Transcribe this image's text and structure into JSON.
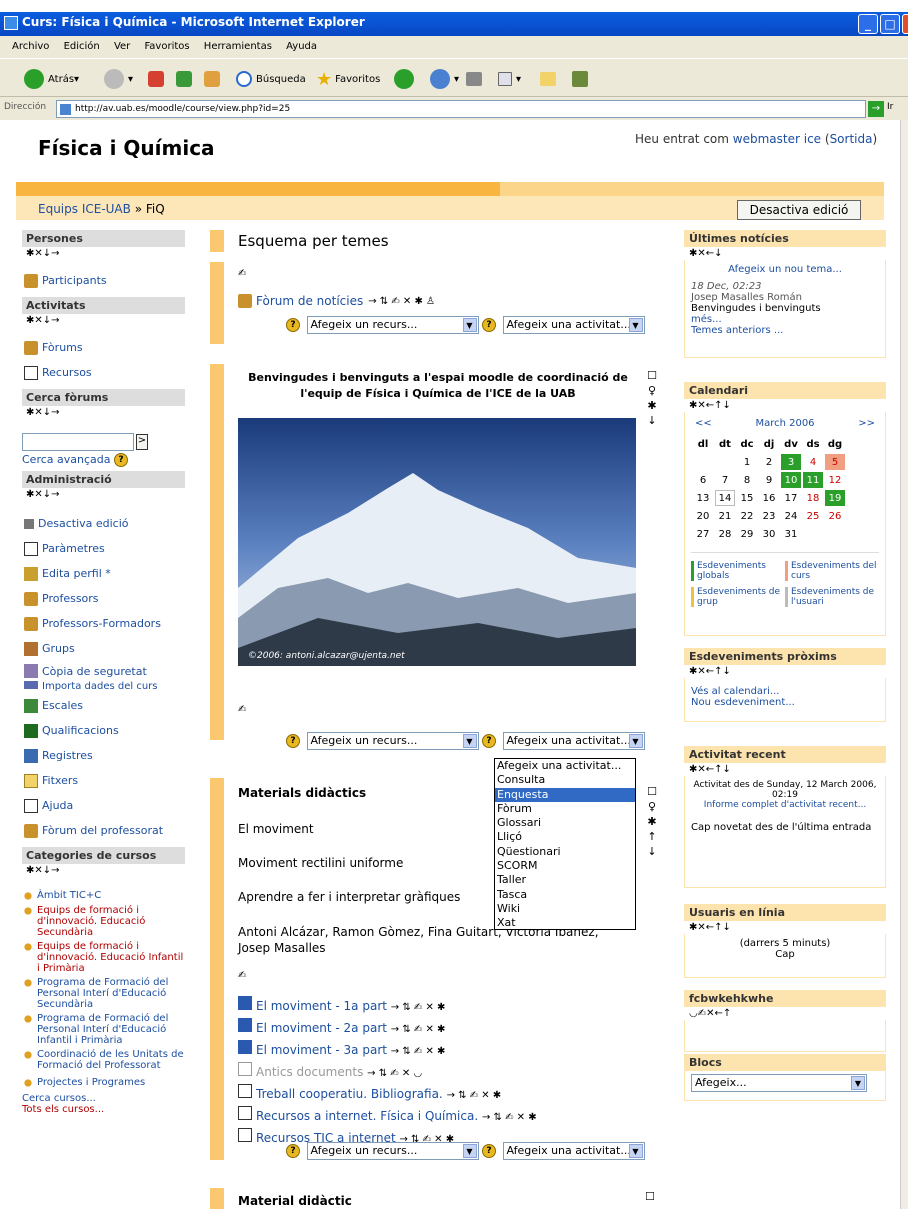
{
  "window": {
    "title": "Curs: Física i Química - Microsoft Internet Explorer"
  },
  "menu": [
    "Archivo",
    "Edición",
    "Ver",
    "Favoritos",
    "Herramientas",
    "Ayuda"
  ],
  "toolbar": {
    "back": "Atrás",
    "search": "Búsqueda",
    "favorites": "Favoritos"
  },
  "address": {
    "label": "Dirección",
    "url": "http://av.uab.es/moodle/course/view.php?id=25",
    "go": "Ir"
  },
  "header": {
    "title": "Física i Química",
    "login_prefix": "Heu entrat com",
    "login_user": "webmaster ice",
    "logout": "Sortida"
  },
  "nav": {
    "crumb1": "Equips ICE-UAB",
    "sep": "»",
    "crumb2": "FiQ",
    "edit_button": "Desactiva edició"
  },
  "controls": "✱✕↓→",
  "left": {
    "persones": {
      "title": "Persones",
      "items": [
        "Participants"
      ]
    },
    "activitats": {
      "title": "Activitats",
      "items": [
        "Fòrums",
        "Recursos"
      ]
    },
    "cerca": {
      "title": "Cerca fòrums",
      "go": ">",
      "advanced": "Cerca avançada"
    },
    "admin": {
      "title": "Administració",
      "items": [
        "Desactiva edició",
        "Paràmetres",
        "Edita perfil *",
        "Professors",
        "Professors-Formadors",
        "Grups",
        "Còpia de seguretat",
        "Importa dades del curs",
        "Escales",
        "Qualificacions",
        "Registres",
        "Fitxers",
        "Ajuda",
        "Fòrum del professorat"
      ]
    },
    "categories": {
      "title": "Categories de cursos",
      "items": [
        "Àmbit TIC+C",
        "Equips de formació i d'innovació. Educació Secundària",
        "Equips de formació i d'innovació. Educació Infantil i Primària",
        "Programa de Formació del Personal Interí d'Educació Secundària",
        "Programa de Formació del Personal Interí d'Educació Infantil i Primària",
        "Coordinació de les Unitats de Formació del Professorat",
        "Projectes i Programes"
      ],
      "search": "Cerca cursos...",
      "all": "Tots els cursos..."
    }
  },
  "main": {
    "heading": "Esquema per temes",
    "forum_link": "Fòrum de notícies",
    "add_resource": "Afegeix un recurs...",
    "add_activity": "Afegeix una activitat...",
    "welcome": "Benvingudes i benvinguts a l'espai moodle de coordinació de l'equip de Física i Química de l'ICE de la UAB",
    "photo_credit": "©2006: antoni.alcazar@ujenta.net",
    "materials_title": "Materials didàctics",
    "topics": [
      "El moviment",
      "Moviment rectilini uniforme",
      "Aprendre a fer i interpretar gràfiques"
    ],
    "authors": "Antoni Alcázar, Ramon Gòmez, Fina Guitart, Victòria Ibàñez, Josep Masalles",
    "resources": [
      "El moviment - 1a part",
      "El moviment - 2a part",
      "El moviment - 3a part",
      "Antics documents",
      "Treball cooperatiu. Bibliografia.",
      "Recursos a internet. Física i Química.",
      "Recursos TIC a internet"
    ],
    "next_section": "Material didàctic",
    "dropdown": [
      "Afegeix una activitat...",
      "Consulta",
      "Enquesta",
      "Fòrum",
      "Glossari",
      "Lliçó",
      "Qüestionari",
      "SCORM",
      "Taller",
      "Tasca",
      "Wiki",
      "Xat"
    ],
    "dropdown_selected": "Enquesta"
  },
  "right": {
    "news": {
      "title": "Últimes notícies",
      "add": "Afegeix un nou tema...",
      "date": "18 Dec, 02:23",
      "author": "Josep Masalles Román",
      "text": "Benvingudes i benvinguts",
      "more": "més...",
      "older": "Temes anteriors ..."
    },
    "calendar": {
      "title": "Calendari",
      "prev": "<<",
      "next": ">>",
      "month": "March 2006",
      "days": [
        "dl",
        "dt",
        "dc",
        "dj",
        "dv",
        "ds",
        "dg"
      ],
      "weeks": [
        [
          "",
          "",
          "1",
          "2",
          "3",
          "4",
          "5"
        ],
        [
          "6",
          "7",
          "8",
          "9",
          "10",
          "11",
          "12"
        ],
        [
          "13",
          "14",
          "15",
          "16",
          "17",
          "18",
          "19"
        ],
        [
          "20",
          "21",
          "22",
          "23",
          "24",
          "25",
          "26"
        ],
        [
          "27",
          "28",
          "29",
          "30",
          "31",
          "",
          ""
        ]
      ],
      "legend": [
        "Esdeveniments globals",
        "Esdeveniments del curs",
        "Esdeveniments de grup",
        "Esdeveniments de l'usuari"
      ]
    },
    "upcoming": {
      "title": "Esdeveniments pròxims",
      "go": "Vés al calendari...",
      "new": "Nou esdeveniment..."
    },
    "recent": {
      "title": "Activitat recent",
      "since": "Activitat des de Sunday, 12 March 2006, 02:19",
      "full": "Informe complet d'activitat recent...",
      "none": "Cap novetat des de l'última entrada"
    },
    "online": {
      "title": "Usuaris en línia",
      "period": "(darrers 5 minuts)",
      "none": "Cap"
    },
    "custom": {
      "title": "fcbwkehkwhe"
    },
    "blocks": {
      "title": "Blocs",
      "add": "Afegeix..."
    }
  }
}
